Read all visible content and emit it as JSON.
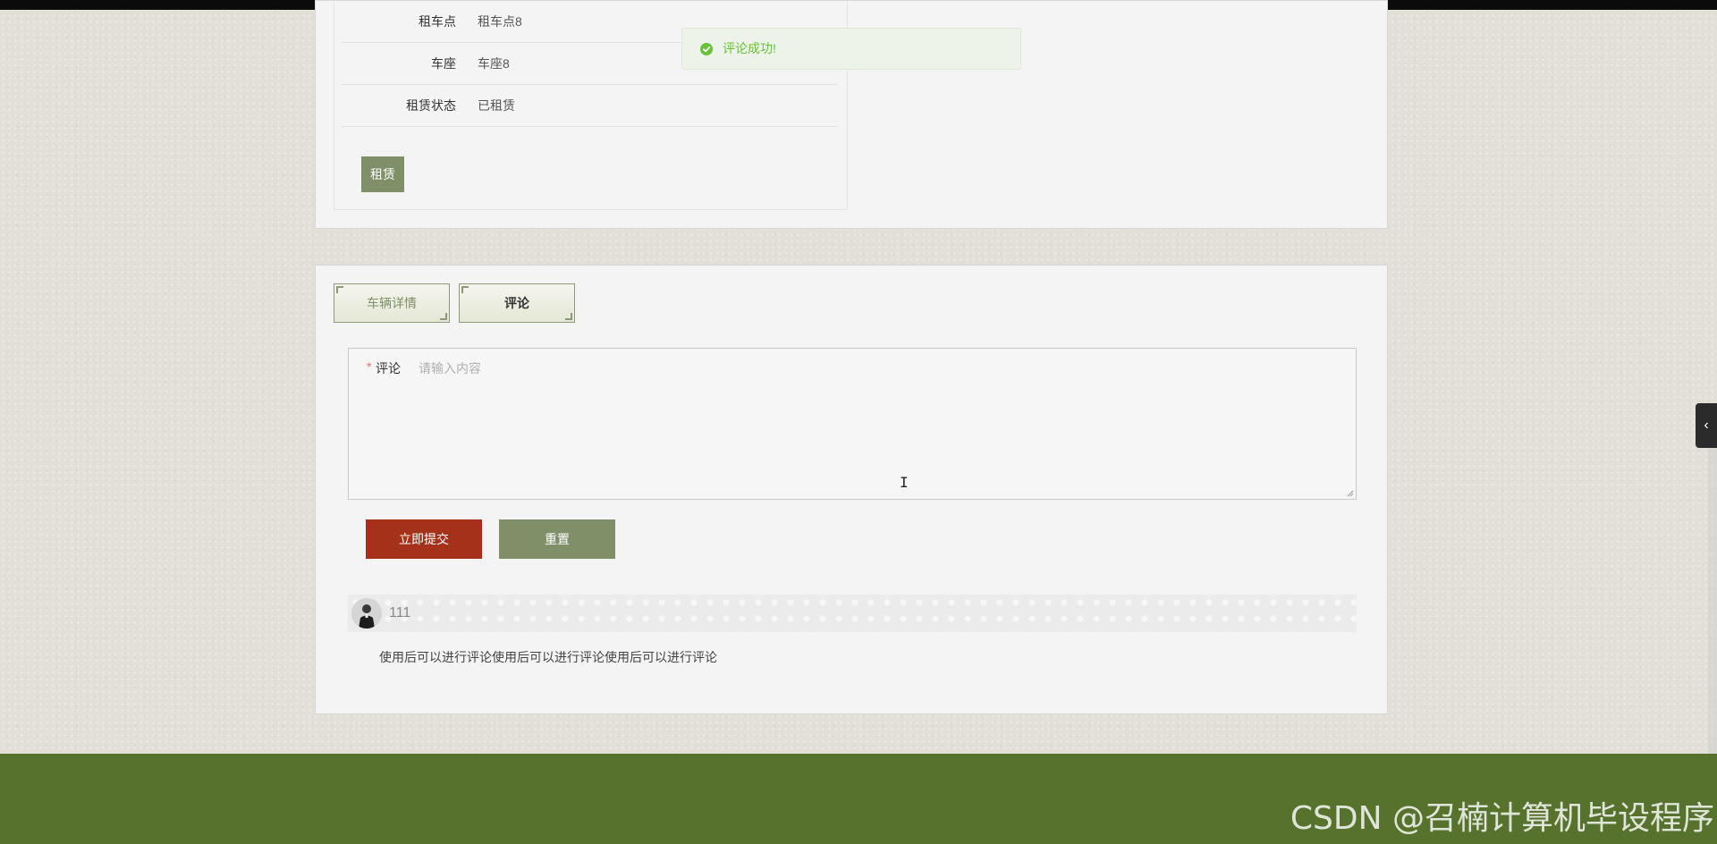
{
  "vehicle_info": {
    "rows": [
      {
        "label": "租车点",
        "value": "租车点8"
      },
      {
        "label": "车座",
        "value": "车座8"
      },
      {
        "label": "租赁状态",
        "value": "已租赁"
      }
    ],
    "rent_button": "租赁"
  },
  "toast": {
    "message": "评论成功!",
    "status_color": "#67c23a"
  },
  "tabs": [
    {
      "label": "车辆详情",
      "active": false
    },
    {
      "label": "评论",
      "active": true
    }
  ],
  "comment_form": {
    "required_mark": "*",
    "label": "评论",
    "placeholder": "请输入内容",
    "value": "",
    "submit_label": "立即提交",
    "reset_label": "重置"
  },
  "comments": [
    {
      "user": "111",
      "content": "使用后可以进行评论使用后可以进行评论使用后可以进行评论"
    }
  ],
  "watermark": "CSDN @召楠计算机毕设程序",
  "side_handle": {
    "icon": "chevron-left-icon",
    "glyph": "‹"
  },
  "colors": {
    "accent_green": "#7f8f67",
    "submit_red": "#a5311b",
    "footer_green": "#57722c"
  }
}
